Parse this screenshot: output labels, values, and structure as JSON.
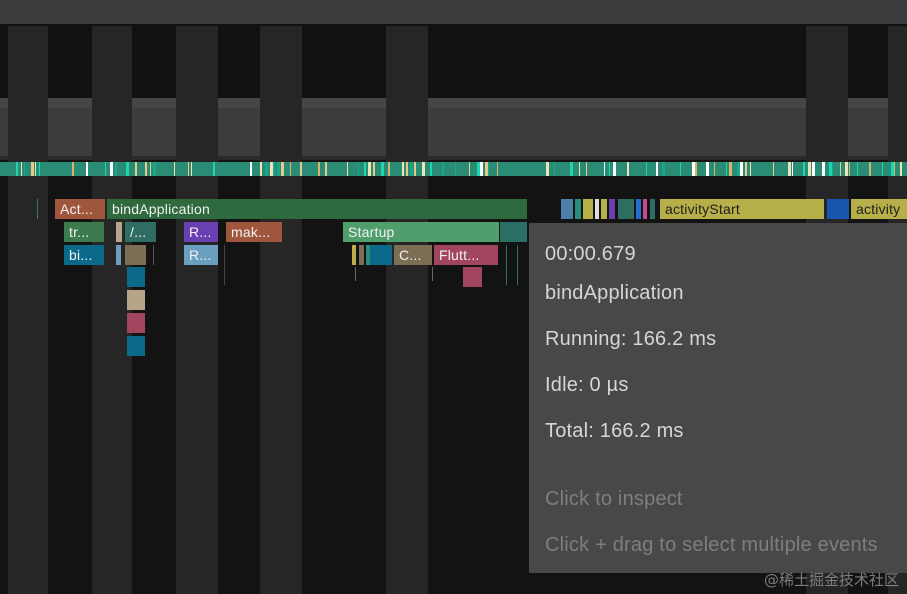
{
  "events": {
    "row1": [
      "Act...",
      "bindApplication",
      "activityStart",
      "activity"
    ],
    "row2": [
      "tr...",
      "/...",
      "R...",
      "mak...",
      "Startup"
    ],
    "row3": [
      "bi...",
      "R...",
      "C...",
      "Flutt..."
    ]
  },
  "tooltip": {
    "time": "00:00.679",
    "name": "bindApplication",
    "running": "Running: 166.2 ms",
    "idle": "Idle: 0 µs",
    "total": "Total: 166.2 ms",
    "hint_click": "Click to inspect",
    "hint_drag": "Click + drag to select multiple events"
  },
  "watermark": "@稀土掘金技术社区",
  "colors": {
    "bindApplication": "#2e6a3e",
    "startup": "#4f9e6b",
    "activityStart": "#b7b04a",
    "act": "#a0563c",
    "tr": "#3d7a4d",
    "slash": "#2f6d63",
    "r_purple": "#6a3fb1",
    "mak": "#a0563c",
    "bi": "#0b6a8a",
    "r_light": "#6a9fbf",
    "c_tan": "#7b6e54",
    "flutt": "#a2465f",
    "tooltip_bg": "#484848"
  }
}
